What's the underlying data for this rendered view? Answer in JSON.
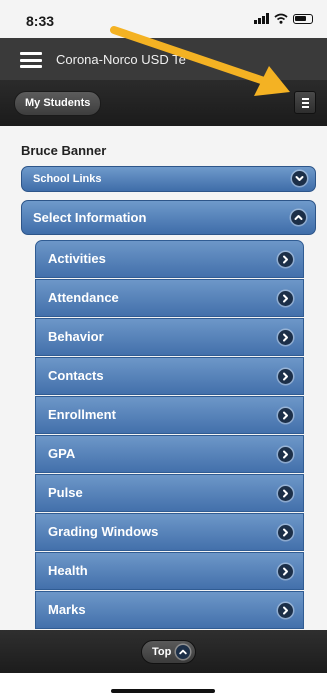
{
  "status_bar": {
    "time": "8:33"
  },
  "app_bar": {
    "title": "Corona-Norco USD Te"
  },
  "toolbar": {
    "my_students_label": "My Students"
  },
  "student": {
    "name": "Bruce Banner"
  },
  "school_links": {
    "label": "School Links"
  },
  "select_information": {
    "label": "Select Information"
  },
  "menu_items": [
    {
      "label": "Activities"
    },
    {
      "label": "Attendance"
    },
    {
      "label": "Behavior"
    },
    {
      "label": "Contacts"
    },
    {
      "label": "Enrollment"
    },
    {
      "label": "GPA"
    },
    {
      "label": "Pulse"
    },
    {
      "label": "Grading Windows"
    },
    {
      "label": "Health"
    },
    {
      "label": "Marks"
    }
  ],
  "bottom_bar": {
    "top_label": "Top"
  },
  "colors": {
    "accent_blue": "#4f7db6",
    "annotation_arrow": "#f4b223",
    "toolbar_dark": "#222222"
  }
}
